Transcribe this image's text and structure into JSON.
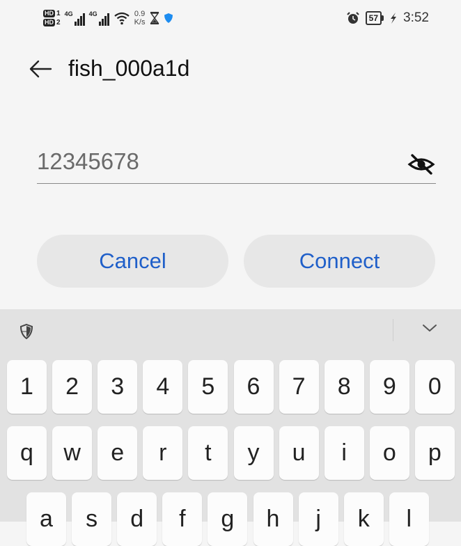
{
  "status_bar": {
    "hd1": "HD",
    "sim1": "1",
    "hd2": "HD",
    "sim2": "2",
    "sig1_label": "4G",
    "sig2_label": "4G",
    "speed_value": "0.9",
    "speed_unit": "K/s",
    "battery": "57",
    "time": "3:52"
  },
  "header": {
    "title": "fish_000a1d"
  },
  "password": {
    "value": "12345678"
  },
  "dialog": {
    "cancel_label": "Cancel",
    "connect_label": "Connect"
  },
  "keyboard": {
    "numbers": [
      "1",
      "2",
      "3",
      "4",
      "5",
      "6",
      "7",
      "8",
      "9",
      "0"
    ],
    "row1": [
      "q",
      "w",
      "e",
      "r",
      "t",
      "y",
      "u",
      "i",
      "o",
      "p"
    ],
    "row2": [
      "a",
      "s",
      "d",
      "f",
      "g",
      "h",
      "j",
      "k",
      "l"
    ]
  },
  "colors": {
    "accent": "#1f5fc9",
    "background": "#f5f5f5",
    "keyboard": "#e2e2e2"
  }
}
